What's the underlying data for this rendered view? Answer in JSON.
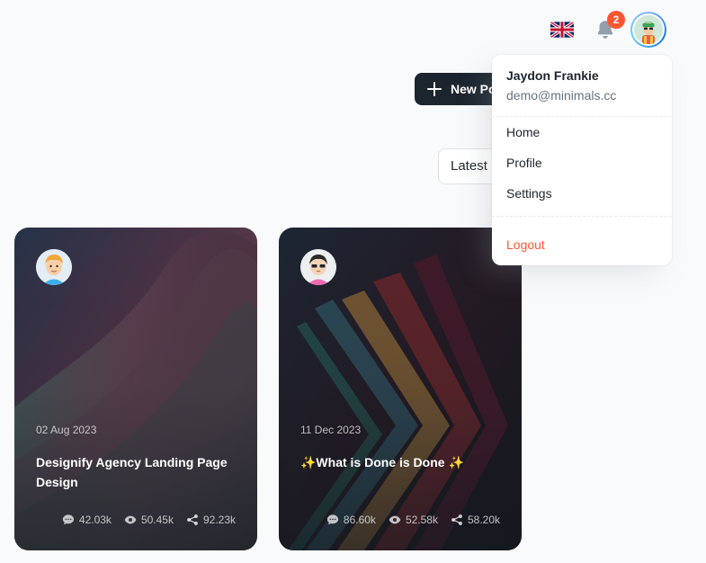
{
  "header": {
    "language": "English",
    "notifications_count": "2"
  },
  "toolbar": {
    "new_post_label": "New Post",
    "sort_value": "Latest"
  },
  "account_menu": {
    "name": "Jaydon Frankie",
    "email": "demo@minimals.cc",
    "items": [
      {
        "label": "Home"
      },
      {
        "label": "Profile"
      },
      {
        "label": "Settings"
      }
    ],
    "logout_label": "Logout"
  },
  "posts": [
    {
      "date": "02 Aug 2023",
      "title": "Designify Agency Landing Page Design",
      "comments": "42.03k",
      "views": "50.45k",
      "shares": "92.23k"
    },
    {
      "date": "11 Dec 2023",
      "title": "✨What is Done is Done ✨",
      "comments": "86.60k",
      "views": "52.58k",
      "shares": "58.20k"
    }
  ],
  "colors": {
    "primary_dark": "#1c252e",
    "error": "#ff5630",
    "text_secondary": "#637381",
    "background": "#f9fafb"
  },
  "icons": {
    "flag": "uk-flag-icon",
    "bell": "bell-icon",
    "plus": "plus-icon",
    "comment": "comment-icon",
    "view": "eye-icon",
    "share": "share-icon"
  }
}
